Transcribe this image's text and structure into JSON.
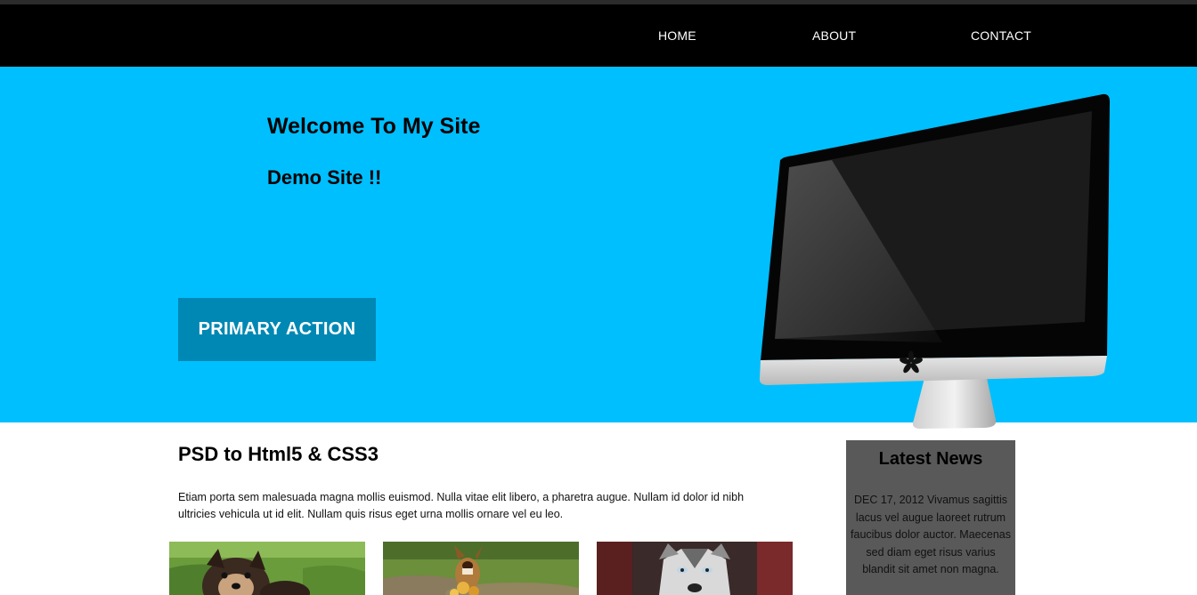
{
  "nav": {
    "links": [
      {
        "label": "HOME"
      },
      {
        "label": "ABOUT"
      },
      {
        "label": "CONTACT"
      }
    ]
  },
  "hero": {
    "title": "Welcome To My Site",
    "subtitle": "Demo Site !!",
    "cta_label": "PRIMARY ACTION",
    "background_color": "#00bfff",
    "cta_color": "#0088b4"
  },
  "main": {
    "title": "PSD to Html5 & CSS3",
    "body": "Etiam porta sem malesuada magna mollis euismod. Nulla vitae elit libero, a pharetra augue. Nullam id dolor id nibh ultricies vehicula ut id elit. Nullam quis risus eget urna mollis ornare vel eu leo."
  },
  "news": {
    "title": "Latest News",
    "text": "DEC 17, 2012 Vivamus sagittis lacus vel augue laoreet rutrum faucibus dolor auctor. Maecenas sed diam eget risus varius blandit sit amet non magna."
  },
  "gallery": [
    {
      "icon": "puppy-photo"
    },
    {
      "icon": "playing-dog-photo"
    },
    {
      "icon": "husky-photo"
    }
  ]
}
